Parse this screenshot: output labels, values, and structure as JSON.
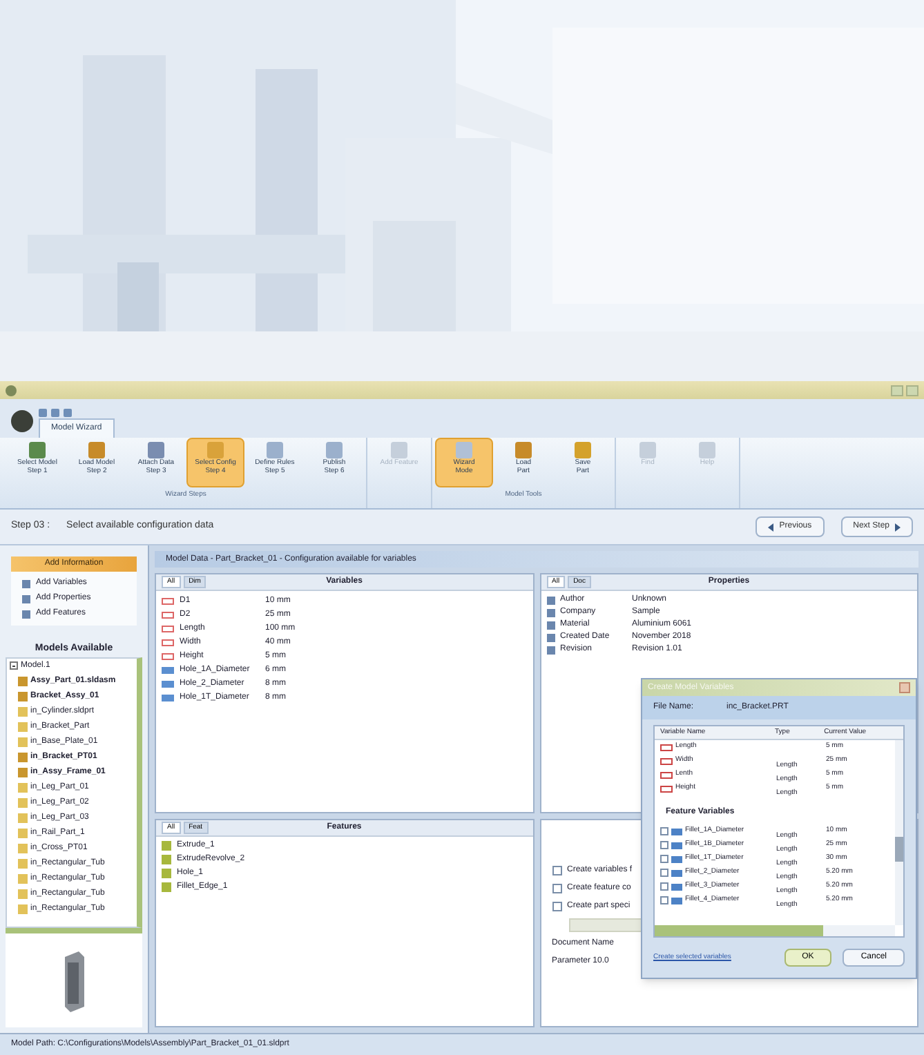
{
  "quick_access": {
    "tab": "Model Wizard"
  },
  "ribbon": {
    "buttons": [
      {
        "label": "Select Model",
        "sub": "Step 1",
        "selected": false,
        "disabled": false
      },
      {
        "label": "Load Model",
        "sub": "Step 2",
        "selected": false,
        "disabled": false
      },
      {
        "label": "Attach Data",
        "sub": "Step 3",
        "selected": false,
        "disabled": false
      },
      {
        "label": "Select Config",
        "sub": "Step 4",
        "selected": true,
        "disabled": false
      },
      {
        "label": "Define Rules",
        "sub": "Step 5",
        "selected": false,
        "disabled": false
      },
      {
        "label": "Publish",
        "sub": "Step 6",
        "selected": false,
        "disabled": false
      },
      {
        "label": "Add Feature",
        "selected": false,
        "disabled": true
      },
      {
        "label": "Wizard",
        "sub": "Mode",
        "selected": true,
        "disabled": false
      },
      {
        "label": "Load",
        "sub": "Part",
        "selected": false,
        "disabled": false
      },
      {
        "label": "Save",
        "sub": "Part",
        "selected": false,
        "disabled": false
      },
      {
        "label": "Find",
        "selected": false,
        "disabled": true
      },
      {
        "label": "Help",
        "selected": false,
        "disabled": true
      }
    ],
    "groups": [
      "Wizard Steps",
      "Model Tools"
    ]
  },
  "step_bar": {
    "step": "Step 03 :",
    "instruction": "Select available configuration data",
    "buttons": [
      "Previous",
      "Next Step"
    ]
  },
  "sidebar": {
    "header": "Add Information",
    "actions": [
      "Add Variables",
      "Add Properties",
      "Add Features"
    ],
    "models_title": "Models Available",
    "tree": [
      {
        "label": "Model.1",
        "expanded": true,
        "children": [
          {
            "label": "Assy_Part_01.sldasm",
            "kind": "assembly"
          },
          {
            "label": "Bracket_Assy_01",
            "kind": "assembly"
          },
          {
            "label": "in_Cylinder.sldprt",
            "kind": "part"
          },
          {
            "label": "in_Bracket_Part",
            "kind": "part"
          },
          {
            "label": "in_Base_Plate_01",
            "kind": "part"
          },
          {
            "label": "in_Bracket_PT01",
            "kind": "assembly"
          },
          {
            "label": "in_Assy_Frame_01",
            "kind": "assembly"
          },
          {
            "label": "in_Leg_Part_01",
            "kind": "part"
          },
          {
            "label": "in_Leg_Part_02",
            "kind": "part"
          },
          {
            "label": "in_Leg_Part_03",
            "kind": "part"
          },
          {
            "label": "in_Rail_Part_1",
            "kind": "part"
          },
          {
            "label": "in_Cross_PT01",
            "kind": "part"
          },
          {
            "label": "in_Rectangular_Tub",
            "kind": "part"
          },
          {
            "label": "in_Rectangular_Tub",
            "kind": "part"
          },
          {
            "label": "in_Rectangular_Tub",
            "kind": "part"
          },
          {
            "label": "in_Rectangular_Tub",
            "kind": "part"
          }
        ]
      }
    ]
  },
  "content_header": "Model Data - Part_Bracket_01 - Configuration available for variables",
  "variables": {
    "title": "Variables",
    "tabs": [
      {
        "label": "All",
        "selected": true
      },
      {
        "label": "Dim",
        "selected": false
      }
    ],
    "rows": [
      {
        "name": "D1",
        "value": "10 mm",
        "kind": "dimension"
      },
      {
        "name": "D2",
        "value": "25 mm",
        "kind": "dimension"
      },
      {
        "name": "Length",
        "value": "100 mm",
        "kind": "dimension"
      },
      {
        "name": "Width",
        "value": "40 mm",
        "kind": "dimension"
      },
      {
        "name": "Height",
        "value": "5 mm",
        "kind": "dimension"
      },
      {
        "name": "Hole_1A_Diameter",
        "value": "6 mm",
        "kind": "hole"
      },
      {
        "name": "Hole_2_Diameter",
        "value": "8 mm",
        "kind": "hole"
      },
      {
        "name": "Hole_1T_Diameter",
        "value": "8 mm",
        "kind": "hole"
      }
    ]
  },
  "properties": {
    "title": "Properties",
    "tabs": [
      {
        "label": "All",
        "selected": true
      },
      {
        "label": "Doc",
        "selected": false
      }
    ],
    "rows": [
      {
        "name": "Author",
        "value": "Unknown"
      },
      {
        "name": "Company",
        "value": "Sample"
      },
      {
        "name": "Material",
        "value": "Aluminium 6061"
      },
      {
        "name": "Created Date",
        "value": "November 2018"
      },
      {
        "name": "Revision",
        "value": "Revision 1.01"
      }
    ]
  },
  "features": {
    "title": "Features",
    "tabs": [
      {
        "label": "All",
        "selected": true
      },
      {
        "label": "Feat",
        "selected": false
      }
    ],
    "rows": [
      "Extrude_1",
      "ExtrudeRevolve_2",
      "Hole_1",
      "Fillet_Edge_1"
    ]
  },
  "options": {
    "checkboxes": [
      {
        "label": "Create variables f",
        "checked": false
      },
      {
        "label": "Create feature co",
        "checked": false
      },
      {
        "label": "Create part speci",
        "checked": false
      }
    ],
    "info": [
      "Document Name",
      "Parameter 10.0"
    ]
  },
  "dialog": {
    "title": "Create Model Variables",
    "file_label": "File Name:",
    "file_value": "inc_Bracket.PRT",
    "columns": [
      "Variable Name",
      "Type",
      "Current Value"
    ],
    "rows": [
      {
        "name": "Length",
        "value": "5 mm"
      },
      {
        "name": "Width",
        "type": "Length",
        "value": "25 mm"
      },
      {
        "name": "Lenth",
        "type": "Length",
        "value": "5 mm"
      },
      {
        "name": "Height",
        "type": "Length",
        "value": "5 mm"
      }
    ],
    "section": "Feature Variables",
    "feature_rows": [
      {
        "name": "Fillet_1A_Diameter",
        "type": "Length",
        "value": "10 mm",
        "checked": false
      },
      {
        "name": "Fillet_1B_Diameter",
        "type": "Length",
        "value": "25 mm",
        "checked": false
      },
      {
        "name": "Fillet_1T_Diameter",
        "type": "Length",
        "value": "30 mm",
        "checked": false
      },
      {
        "name": "Fillet_2_Diameter",
        "type": "Length",
        "value": "5.20 mm",
        "checked": false
      },
      {
        "name": "Fillet_3_Diameter",
        "type": "Length",
        "value": "5.20 mm",
        "checked": false
      },
      {
        "name": "Fillet_4_Diameter",
        "type": "Length",
        "value": "5.20 mm",
        "checked": false
      }
    ],
    "link": "Create selected variables",
    "buttons": [
      "OK",
      "Cancel"
    ]
  },
  "status_bar": "Model Path: C:\\Configurations\\Models\\Assembly\\Part_Bracket_01_01.sldprt"
}
